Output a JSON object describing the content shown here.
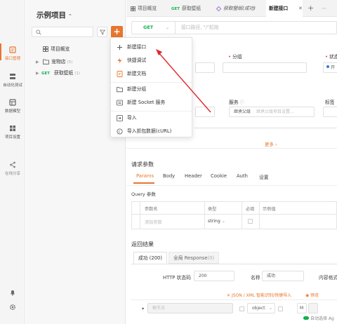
{
  "colors": {
    "accent": "#e8762d",
    "get": "#10b14a",
    "required": "#e0413d",
    "arrow": "#e0262c"
  },
  "rail": {
    "items": [
      {
        "label": "接口管理",
        "icon": "api-icon",
        "active": true
      },
      {
        "label": "自动化测试",
        "icon": "automation-icon"
      },
      {
        "label": "数据模型",
        "icon": "data-model-icon"
      },
      {
        "label": "项目设置",
        "icon": "settings-icon"
      },
      {
        "label": "在线分享",
        "icon": "share-icon"
      }
    ]
  },
  "tree": {
    "project_title": "示例项目",
    "caret": "⌃",
    "add_label": "+",
    "rows": [
      {
        "label": "项目概览",
        "icon": "grid-icon"
      },
      {
        "label": "宠物店",
        "count": "(5)",
        "icon": "folder-icon"
      },
      {
        "method": "GET",
        "label": "获取壁纸",
        "count": "(1)"
      }
    ]
  },
  "tabs": {
    "items": [
      {
        "label": "项目概览",
        "icon": "grid-icon"
      },
      {
        "method": "GET",
        "label": "获取壁纸"
      },
      {
        "label": "获取壁纸(成功)",
        "icon": "example-icon"
      },
      {
        "label": "新建接口",
        "active": true
      }
    ],
    "close": "✕",
    "plus": "+",
    "more": "⋯"
  },
  "url_bar": {
    "method": "GET",
    "placeholder": "接口路径, \"/\"起始"
  },
  "form": {
    "group_label": "分组",
    "status_label": "状态",
    "status_value": "开",
    "service_label": "服务",
    "service_value": "继承父级",
    "service_placeholder": "继承父级项目设置...",
    "tags_label": "标签",
    "more_link": "更多 ›"
  },
  "request": {
    "title": "请求参数",
    "tabs": [
      "Params",
      "Body",
      "Header",
      "Cookie",
      "Auth",
      "设置"
    ],
    "query_title": "Query 参数",
    "columns": [
      "参数名",
      "类型",
      "必填",
      "示例值"
    ],
    "new_param_placeholder": "添加参数",
    "new_param_type": "string"
  },
  "response": {
    "title": "返回结果",
    "tabs": [
      {
        "label": "成功 (200)"
      },
      {
        "label": "全局 Response",
        "count": "(0)"
      }
    ],
    "http_code_label": "HTTP 状态码",
    "http_code_value": "200",
    "name_label": "名称",
    "name_value": "成功",
    "content_type_label": "内容格式",
    "json_link": "JSON / XML 智能识别/快捷导入",
    "preview_link": "预览",
    "root_placeholder": "根节点",
    "root_type": "object",
    "root_m": "M",
    "auto_sort": "自动选择 Ag"
  },
  "menu": {
    "items": [
      {
        "label": "新建接口",
        "icon": "plus-icon"
      },
      {
        "label": "快捷调试",
        "icon": "quick-debug-icon"
      },
      {
        "label": "新建文档",
        "icon": "markdown-icon"
      },
      {
        "label": "新建分组",
        "icon": "new-folder-icon"
      },
      {
        "label": "新建 Socket 服务",
        "icon": "socket-icon"
      },
      {
        "label": "导入",
        "icon": "import-icon"
      },
      {
        "label": "导入抓包数据(cURL)",
        "icon": "curl-icon"
      }
    ]
  }
}
